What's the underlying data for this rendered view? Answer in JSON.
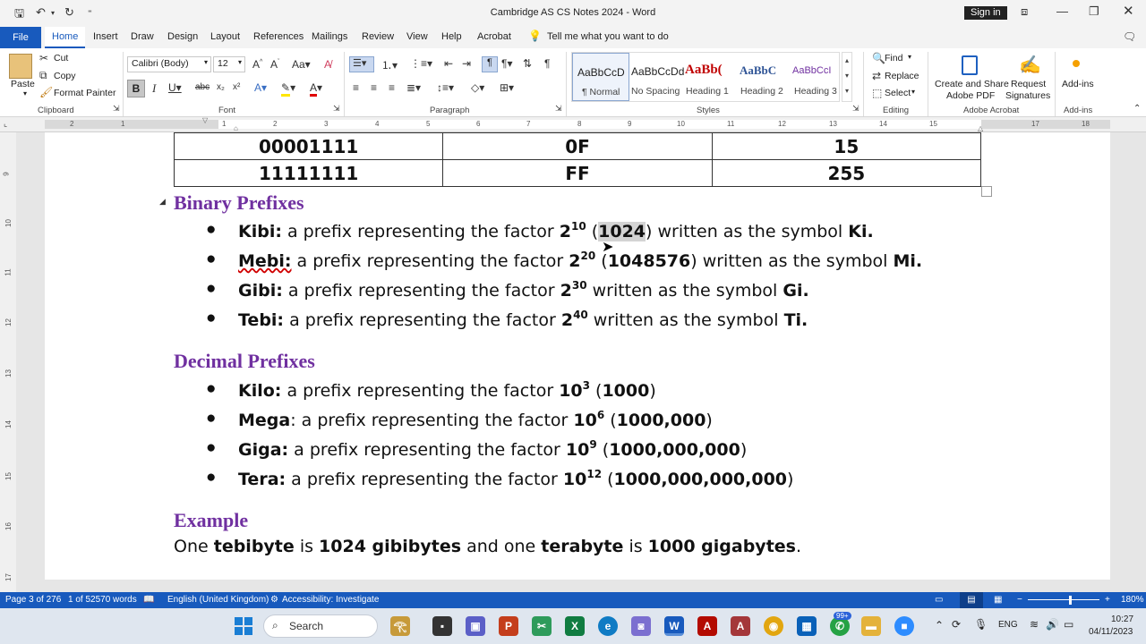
{
  "window": {
    "title": "Cambridge AS CS Notes 2024 - Word",
    "sign_in": "Sign in"
  },
  "tabs": [
    "File",
    "Home",
    "Insert",
    "Draw",
    "Design",
    "Layout",
    "References",
    "Mailings",
    "Review",
    "View",
    "Help",
    "Acrobat"
  ],
  "tell_me": "Tell me what you want to do",
  "ribbon": {
    "clipboard": {
      "paste": "Paste",
      "cut": "Cut",
      "copy": "Copy",
      "format_painter": "Format Painter",
      "label": "Clipboard"
    },
    "font": {
      "name": "Calibri (Body)",
      "size": "12",
      "label": "Font"
    },
    "paragraph": {
      "label": "Paragraph"
    },
    "styles": {
      "label": "Styles",
      "items": [
        {
          "preview": "AaBbCcD",
          "name": "¶ Normal",
          "color": "#222"
        },
        {
          "preview": "AaBbCcDd",
          "name": "No Spacing",
          "color": "#222"
        },
        {
          "preview": "AaBb(",
          "name": "Heading 1",
          "color": "#c00000"
        },
        {
          "preview": "AaBbC",
          "name": "Heading 2",
          "color": "#2f5496"
        },
        {
          "preview": "AaBbCcI",
          "name": "Heading 3",
          "color": "#7030a0"
        }
      ]
    },
    "editing": {
      "find": "Find",
      "replace": "Replace",
      "select": "Select",
      "label": "Editing"
    },
    "acrobat": {
      "create": "Create and Share",
      "create2": "Adobe PDF",
      "request": "Request",
      "request2": "Signatures",
      "label": "Adobe Acrobat"
    },
    "addins": {
      "button": "Add-ins",
      "label": "Add-ins"
    }
  },
  "ruler": {
    "numbers": [
      "2",
      "1",
      "1",
      "2",
      "3",
      "4",
      "5",
      "6",
      "7",
      "8",
      "9",
      "10",
      "11",
      "12",
      "13",
      "14",
      "15",
      "17",
      "18"
    ],
    "vnumbers": [
      "9",
      "10",
      "11",
      "12",
      "13",
      "14",
      "15",
      "16",
      "17"
    ]
  },
  "document": {
    "table_rows": [
      [
        "00001111",
        "0F",
        "15"
      ],
      [
        "11111111",
        "FF",
        "255"
      ]
    ],
    "binary_heading": "Binary Prefixes",
    "binary": [
      {
        "term": "Kibi:",
        "text": " a prefix representing the factor ",
        "base": "2",
        "exp": "10",
        "open": " (",
        "value": "1024",
        "close": ")",
        "tail": " written as the symbol ",
        "sym": "Ki."
      },
      {
        "term": "Mebi:",
        "text": " a prefix representing the factor ",
        "base": "2",
        "exp": "20",
        "open": " (",
        "value": "1048576",
        "close": ")",
        "tail": " written as the symbol ",
        "sym": "Mi."
      },
      {
        "term": "Gibi:",
        "text": " a prefix representing the factor ",
        "base": "2",
        "exp": "30",
        "tail": " written as the symbol ",
        "sym": "Gi."
      },
      {
        "term": "Tebi:",
        "text": " a prefix representing the factor ",
        "base": "2",
        "exp": "40",
        "tail": " written as the symbol ",
        "sym": "Ti."
      }
    ],
    "decimal_heading": "Decimal Prefixes",
    "decimal": [
      {
        "term": "Kilo:",
        "text": " a prefix representing the factor ",
        "base": "10",
        "exp": "3",
        "open": " (",
        "value": "1000",
        "close": ")"
      },
      {
        "term": "Mega",
        "text": ": a prefix representing the factor ",
        "base": "10",
        "exp": "6",
        "open": " (",
        "value": "1000,000",
        "close": ")"
      },
      {
        "term": "Giga:",
        "text": " a prefix representing the factor ",
        "base": "10",
        "exp": "9",
        "open": " (",
        "value": "1000,000,000",
        "close": ")"
      },
      {
        "term": "Tera:",
        "text": " a prefix representing the factor ",
        "base": "10",
        "exp": "12",
        "open": " (",
        "value": "1000,000,000,000",
        "close": ")"
      }
    ],
    "example_heading": "Example",
    "example": {
      "a": "One ",
      "b": "tebibyte",
      "c": " is ",
      "d": "1024 gibibytes",
      "e": " and one ",
      "f": "terabyte",
      "g": " is ",
      "h": "1000 gigabytes",
      "i": "."
    }
  },
  "status": {
    "page": "Page 3 of 276",
    "words": "1 of 52570 words",
    "language": "English (United Kingdom)",
    "accessibility": "Accessibility: Investigate",
    "zoom": "180%"
  },
  "taskbar": {
    "search": "Search",
    "badge": "99+",
    "lang": "ENG",
    "time": "10:27",
    "date": "04/11/2023"
  }
}
